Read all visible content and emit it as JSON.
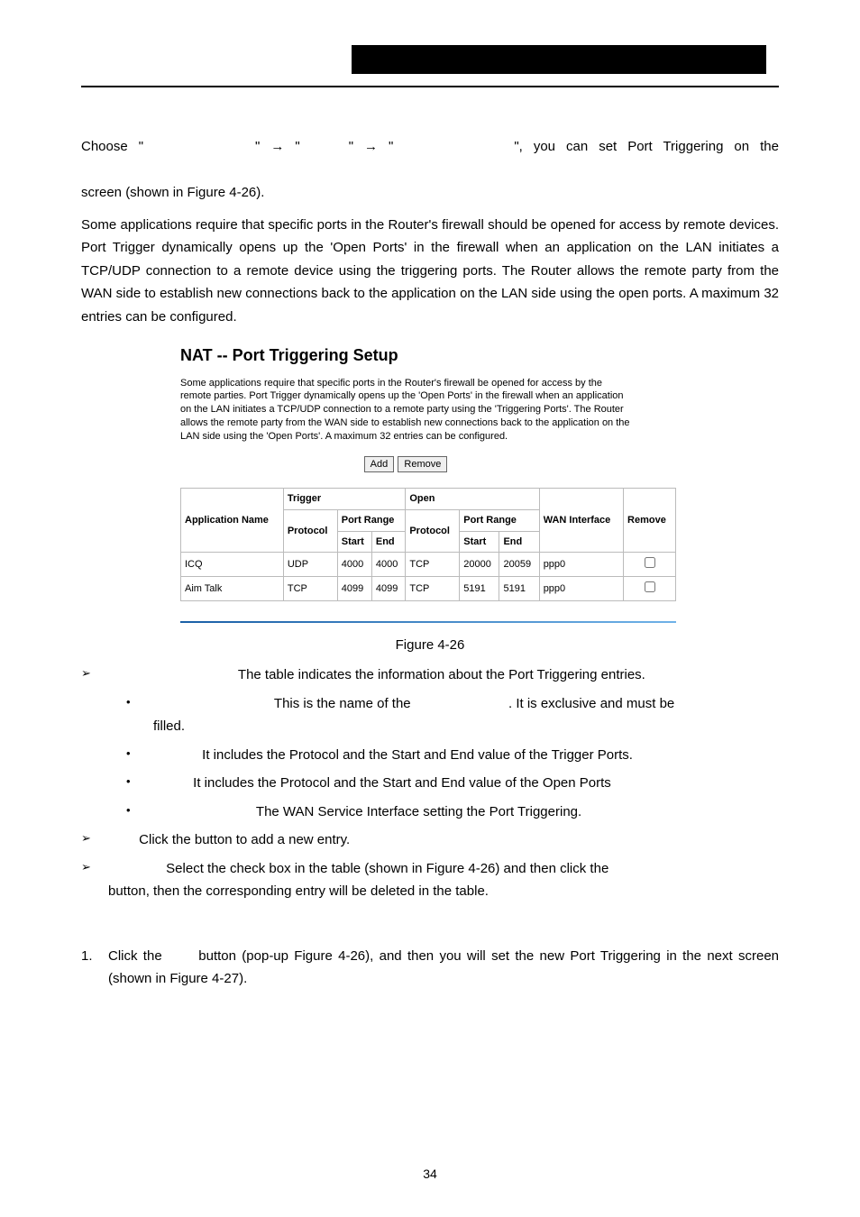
{
  "nav_line_a": "Choose  \"",
  "nav_line_b": "\"",
  "nav_line_c": "\"",
  "nav_line_d": "\"",
  "nav_line_e": "\"",
  "nav_line_f": "\",  you  can  set  Port  Triggering  on  the",
  "nav_line2": "screen (shown in Figure 4-26).",
  "intro_para": "Some applications require that specific ports in the Router's firewall should be opened for access by remote devices. Port Trigger dynamically opens up the 'Open Ports' in the firewall when an application on the LAN initiates a TCP/UDP connection to a remote device using the triggering ports. The Router allows the remote party from the WAN side to establish new connections back to the application on the LAN side using the open ports. A maximum 32 entries can be configured.",
  "figure": {
    "title": "NAT -- Port Triggering Setup",
    "desc": "Some applications require that specific ports in the Router's firewall be opened for access by the remote parties. Port Trigger dynamically opens up the 'Open Ports' in the firewall when an application on the LAN initiates a TCP/UDP connection to a remote party using the 'Triggering Ports'. The Router allows the remote party from the WAN side to establish new connections back to the application on the LAN side using the 'Open Ports'. A maximum 32 entries can be configured.",
    "add_label": "Add",
    "remove_label": "Remove",
    "headers": {
      "app": "Application Name",
      "trigger": "Trigger",
      "open": "Open",
      "protocol": "Protocol",
      "portrange": "Port Range",
      "start": "Start",
      "end": "End",
      "wan": "WAN Interface",
      "remove": "Remove"
    },
    "rows": [
      {
        "app": "ICQ",
        "t_proto": "UDP",
        "t_start": "4000",
        "t_end": "4000",
        "o_proto": "TCP",
        "o_start": "20000",
        "o_end": "20059",
        "wan": "ppp0"
      },
      {
        "app": "Aim Talk",
        "t_proto": "TCP",
        "t_start": "4099",
        "t_end": "4099",
        "o_proto": "TCP",
        "o_start": "5191",
        "o_end": "5191",
        "wan": "ppp0"
      }
    ]
  },
  "caption": "Figure 4-26",
  "bullets": {
    "l1_1": "The table indicates the information about the Port Triggering entries.",
    "l2_1_a": "This is the name of the ",
    "l2_1_b": ". It is exclusive and must be",
    "l2_1_cont": "filled.",
    "l2_2": "It includes the Protocol and the Start and End value of the Trigger Ports.",
    "l2_3": "It includes the Protocol and the Start and End value of the Open Ports",
    "l2_4": "The WAN Service Interface setting the Port Triggering.",
    "l1_2": "Click the button to add a new entry.",
    "l1_3a": "Select the check box in the table (shown in Figure 4-26) and then click the",
    "l1_3b": "button, then the corresponding entry will be deleted in the table."
  },
  "step1_a": "Click  the ",
  "step1_b": " button  (pop-up  Figure  4-26),  and  then  you  will  set  the  new  Port  Triggering  in the next screen (shown in Figure 4-27).",
  "pagenum": "34"
}
